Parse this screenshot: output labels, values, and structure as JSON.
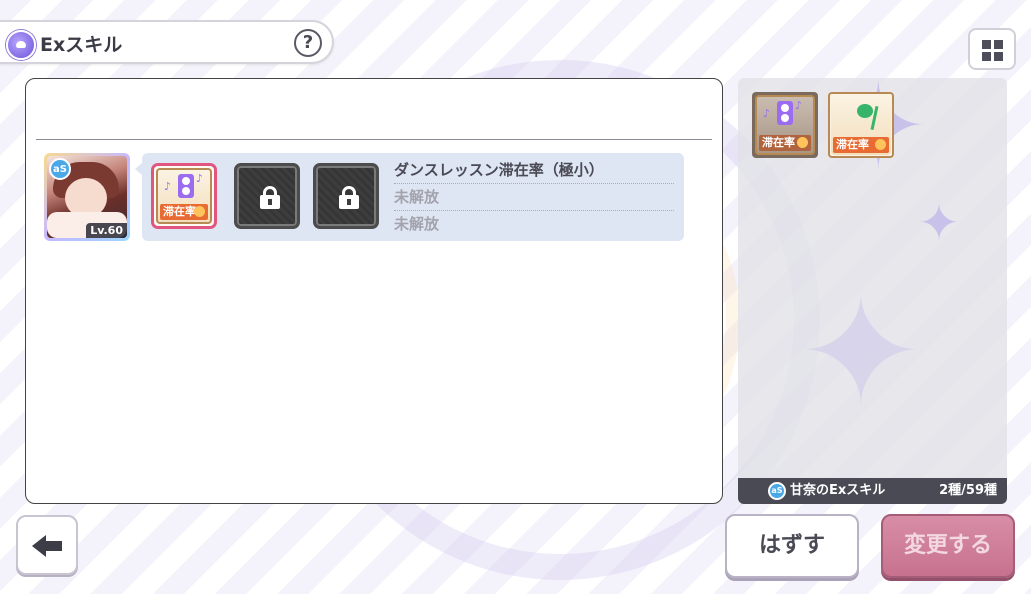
{
  "header": {
    "title": "Exスキル",
    "help_label": "?"
  },
  "character": {
    "level": "Lv.60",
    "badge": "aS"
  },
  "skill_slots": [
    {
      "state": "active",
      "tag": "滞在率",
      "icon": "speaker-icon"
    },
    {
      "state": "locked",
      "icon": "lock-icon"
    },
    {
      "state": "locked",
      "icon": "lock-icon"
    }
  ],
  "skill_lines": [
    "ダンスレッスン滞在率（極小）",
    "未解放",
    "未解放"
  ],
  "side_panel": {
    "icons": [
      {
        "tag": "滞在率",
        "icon": "speaker-icon"
      },
      {
        "tag": "滞在率",
        "icon": "mic-stand-icon"
      }
    ],
    "footer_badge": "aS",
    "footer_name": "甘奈のExスキル",
    "footer_count": "2種/59種"
  },
  "buttons": {
    "remove": "はずす",
    "change": "変更する"
  },
  "colors": {
    "active_border": "#e2557e",
    "tag": "#e86b33",
    "change_button": "#c7728f"
  }
}
